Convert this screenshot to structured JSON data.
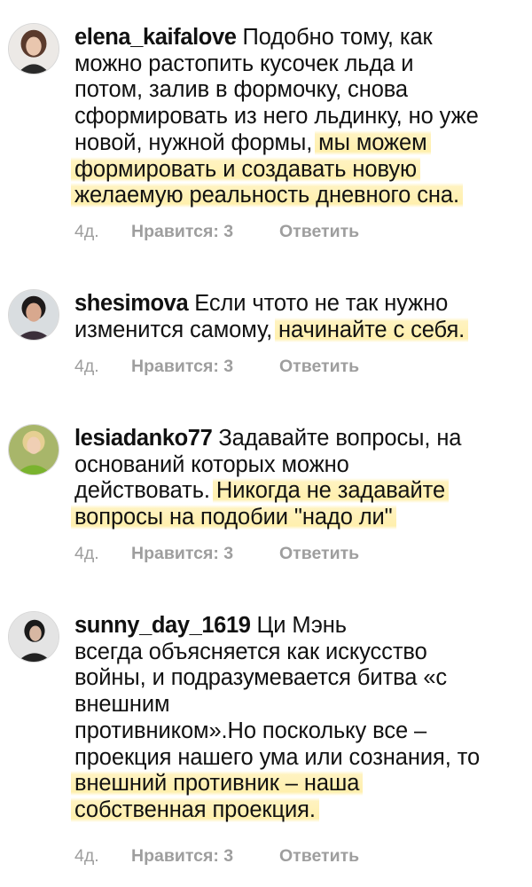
{
  "comments": [
    {
      "username": "elena_kaifalove",
      "lines": [
        {
          "plain": " Подобно тому, как",
          "hl": ""
        },
        {
          "plain": "можно растопить кусочек льда и",
          "hl": ""
        },
        {
          "plain": "потом, залив в формочку, снова",
          "hl": ""
        },
        {
          "plain": "сформировать из него льдинку, но уже",
          "hl": ""
        },
        {
          "plain": "новой, нужной формы, ",
          "hl": "мы можем"
        },
        {
          "plain": "",
          "hl": "формировать и создавать новую"
        },
        {
          "plain": "",
          "hl": "желаемую реальность дневного сна."
        }
      ],
      "time": "4д.",
      "likes": "Нравится: 3",
      "reply": "Ответить"
    },
    {
      "username": "shesimova",
      "lines": [
        {
          "plain": " Если чтото не так нужно",
          "hl": ""
        },
        {
          "plain": "изменится самому, ",
          "hl": "начинайте с себя."
        }
      ],
      "time": "4д.",
      "likes": "Нравится: 3",
      "reply": "Ответить"
    },
    {
      "username": "lesiadanko77",
      "lines": [
        {
          "plain": " Задавайте вопросы, на",
          "hl": ""
        },
        {
          "plain": "оснований которых можно",
          "hl": ""
        },
        {
          "plain": "действовать. ",
          "hl": "Никогда не задавайте"
        },
        {
          "plain": "",
          "hl": "вопросы на подобии \"надо ли\""
        }
      ],
      "time": "4д.",
      "likes": "Нравится: 3",
      "reply": "Ответить"
    },
    {
      "username": "sunny_day_1619",
      "lines": [
        {
          "plain": " Ци Мэнь",
          "hl": ""
        },
        {
          "plain": "всегда объясняется как искусство",
          "hl": ""
        },
        {
          "plain": "войны, и подразумевается битва «с",
          "hl": ""
        },
        {
          "plain": "внешним",
          "hl": ""
        },
        {
          "plain": "противником».Но поскольку все –",
          "hl": ""
        },
        {
          "plain": "проекция нашего ума или сознания, то",
          "hl": ""
        },
        {
          "plain": "",
          "hl": "внешний противник – наша"
        },
        {
          "plain": "",
          "hl": "собственная проекция."
        }
      ],
      "time": "4д.",
      "likes": "Нравится: 3",
      "reply": "Ответить"
    }
  ],
  "icons": [
    "avatar-elena",
    "avatar-shesimova",
    "avatar-lesiadanko",
    "avatar-sunny"
  ]
}
